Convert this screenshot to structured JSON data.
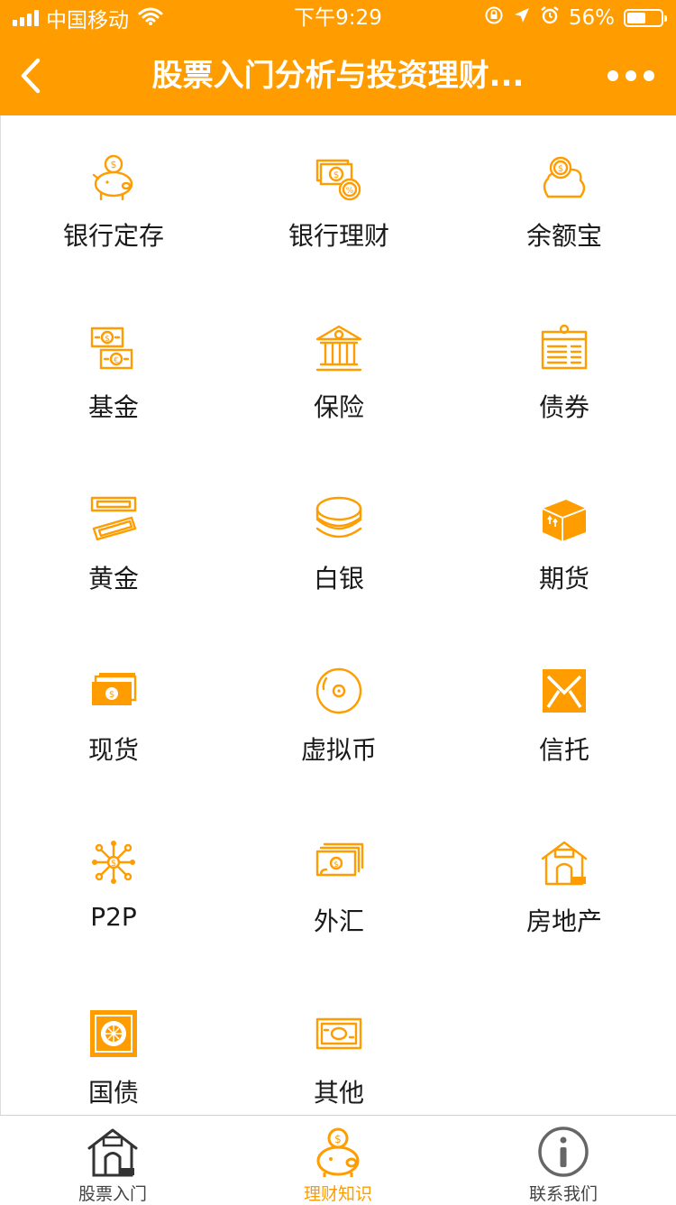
{
  "status_bar": {
    "carrier": "中国移动",
    "time": "下午9:29",
    "battery": "56%",
    "battery_level": 0.56,
    "icons": [
      "signal-icon",
      "wifi-icon",
      "rotation-lock-icon",
      "location-icon",
      "alarm-icon",
      "battery-icon"
    ]
  },
  "nav": {
    "title": "股票入门分析与投资理财...",
    "back_icon": "chevron-left-icon",
    "more_icon": "more-dots-icon"
  },
  "grid": {
    "items": [
      {
        "label": "银行定存",
        "icon": "piggy-bank-icon"
      },
      {
        "label": "银行理财",
        "icon": "cash-coin-icon"
      },
      {
        "label": "余额宝",
        "icon": "coin-bag-icon"
      },
      {
        "label": "基金",
        "icon": "currency-notes-icon"
      },
      {
        "label": "保险",
        "icon": "bank-building-icon"
      },
      {
        "label": "债券",
        "icon": "bond-document-icon"
      },
      {
        "label": "黄金",
        "icon": "gold-bars-icon"
      },
      {
        "label": "白银",
        "icon": "coin-stack-icon"
      },
      {
        "label": "期货",
        "icon": "cargo-box-icon"
      },
      {
        "label": "现货",
        "icon": "banknote-stack-icon"
      },
      {
        "label": "虚拟币",
        "icon": "virtual-coin-icon"
      },
      {
        "label": "信托",
        "icon": "envelope-icon"
      },
      {
        "label": "P2P",
        "icon": "network-icon"
      },
      {
        "label": "外汇",
        "icon": "money-stack-icon"
      },
      {
        "label": "房地产",
        "icon": "house-icon"
      },
      {
        "label": "国债",
        "icon": "treasury-note-icon"
      },
      {
        "label": "其他",
        "icon": "banknote-icon"
      }
    ]
  },
  "tabbar": {
    "tabs": [
      {
        "label": "股票入门",
        "icon": "house-tab-icon",
        "active": false
      },
      {
        "label": "理财知识",
        "icon": "piggy-bank-tab-icon",
        "active": true
      },
      {
        "label": "联系我们",
        "icon": "info-icon",
        "active": false
      }
    ]
  },
  "colors": {
    "accent": "#FF9D00",
    "text": "#1a1a1a",
    "inactive_tab": "#444444"
  }
}
